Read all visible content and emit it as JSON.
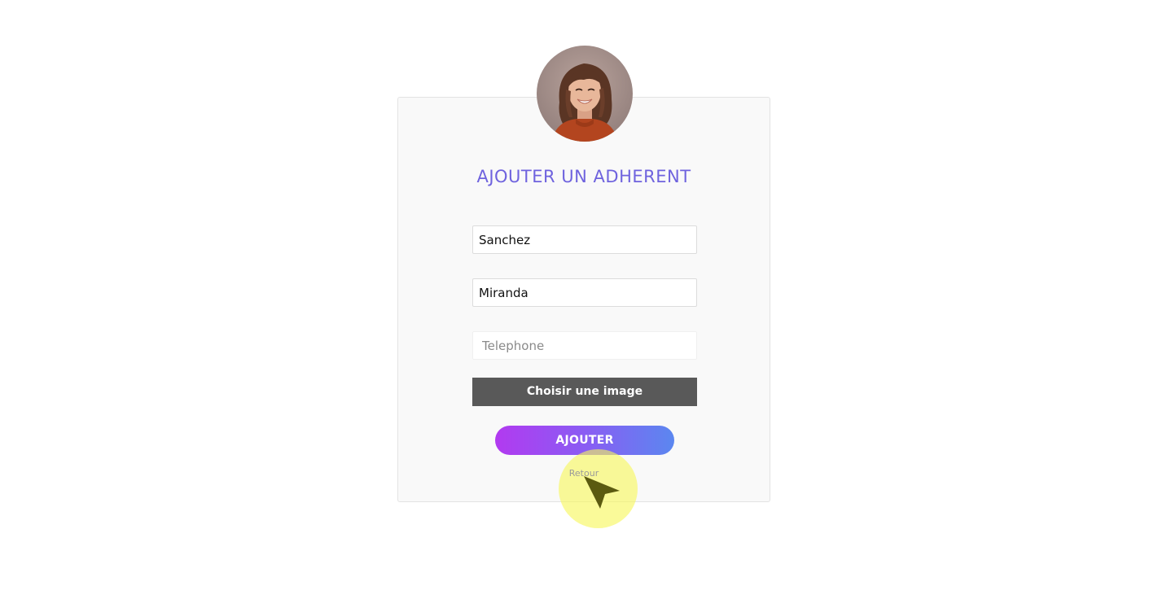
{
  "form": {
    "title": "AJOUTER UN ADHERENT",
    "nom_value": "Sanchez",
    "prenom_value": "Miranda",
    "telephone_value": "",
    "telephone_placeholder": "Telephone",
    "file_button_label": "Choisir une image",
    "submit_label": "AJOUTER",
    "back_link_label": "Retour"
  },
  "icons": {
    "avatar": "profile-photo-woman-icon",
    "cursor": "mouse-pointer-icon"
  },
  "colors": {
    "title": "#6f63de",
    "card_background": "#f9f9f9",
    "file_button": "#595959",
    "submit_gradient_start": "#b23af0",
    "submit_gradient_end": "#5b87f0",
    "cursor_highlight": "#f7f75a"
  }
}
